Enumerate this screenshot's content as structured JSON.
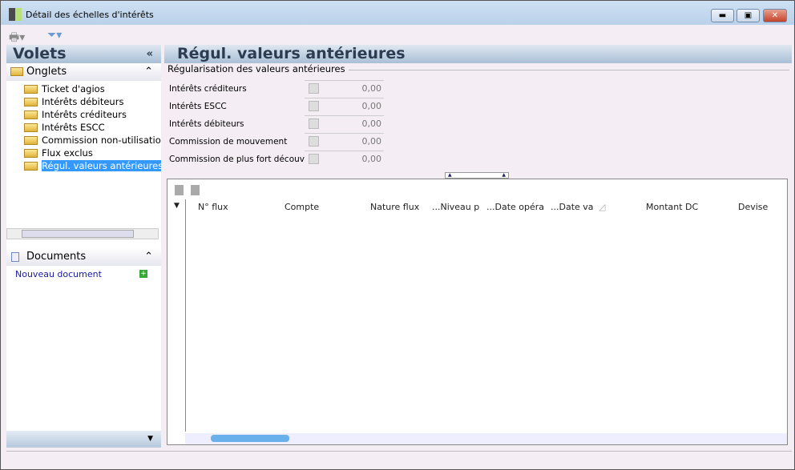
{
  "window": {
    "title": "Détail des échelles d'intérêts"
  },
  "left": {
    "title": "Volets",
    "onglets": "Onglets",
    "items": [
      "Ticket d'agios",
      "Intérêts débiteurs",
      "Intérêts créditeurs",
      "Intérêts ESCC",
      "Commission non-utilisation",
      "Flux exclus",
      "Régul. valeurs antérieures"
    ],
    "documents": "Documents",
    "new_doc": "Nouveau document"
  },
  "main": {
    "title": "Régul. valeurs antérieures",
    "group": "Régularisation des valeurs antérieures",
    "fields": [
      {
        "label": "Intérêts créditeurs",
        "value": "0,00"
      },
      {
        "label": "Intérêts ESCC",
        "value": "0,00"
      },
      {
        "label": "Intérêts débiteurs",
        "value": "0,00"
      },
      {
        "label": "Commission de mouvement",
        "value": "0,00"
      },
      {
        "label": "Commission de plus fort découvert",
        "value": "0,00"
      }
    ],
    "columns": [
      "N° flux",
      "Compte",
      "Nature flux",
      "...Niveau p",
      "...Date opéra",
      "...Date va",
      "Montant DC",
      "Devise"
    ]
  }
}
